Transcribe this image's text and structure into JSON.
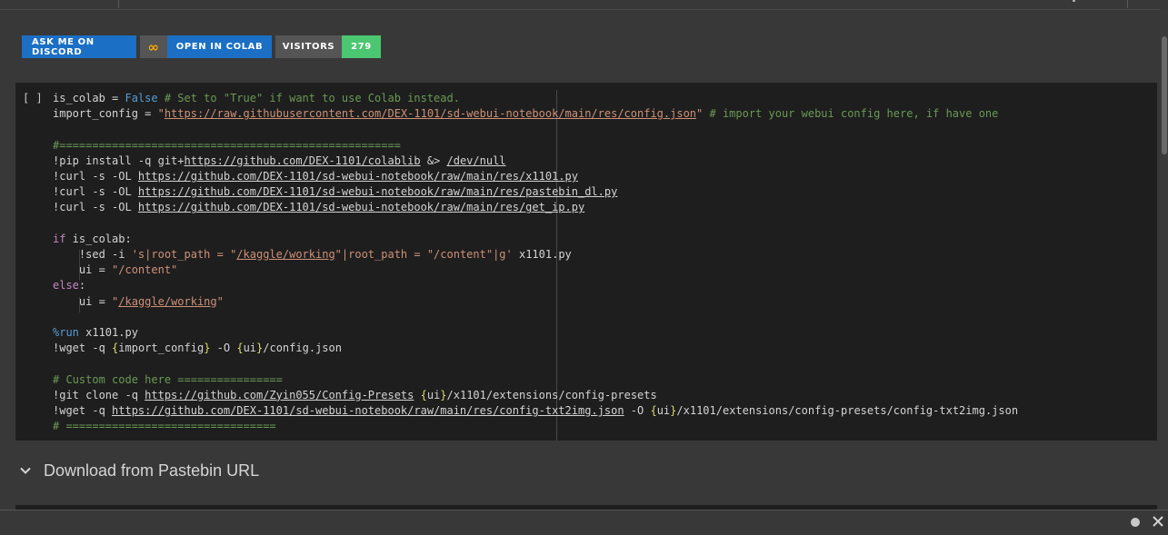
{
  "badges": {
    "discord": "ASK ME ON DISCORD",
    "infinity": "∞",
    "colab": "OPEN IN COLAB",
    "visitors_label": "VISITORS",
    "visitors_count": "279"
  },
  "cell": {
    "run_indicator": "[ ]"
  },
  "section": {
    "title": "Download from Pastebin URL",
    "icon": "chevron-down-icon"
  },
  "colors": {
    "discord_blue": "#1b6fc4",
    "visitors_green": "#4bc671",
    "colab_orange": "#f9ab00",
    "code_bg": "#1e1e1e"
  }
}
